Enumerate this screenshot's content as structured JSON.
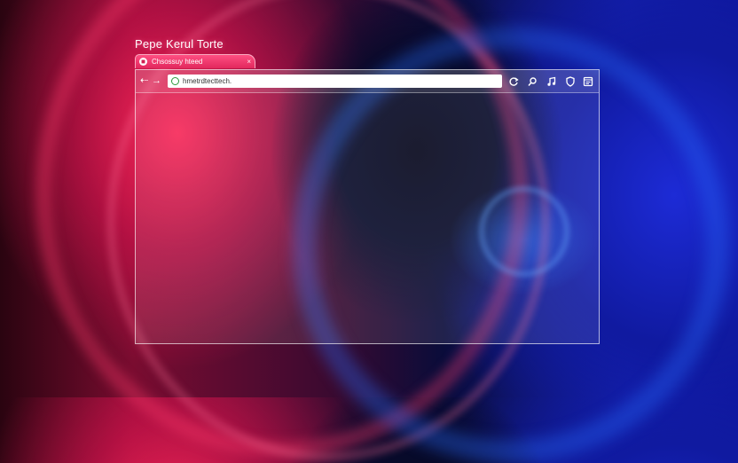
{
  "page": {
    "title": "Pepe Kerul Torte"
  },
  "tab": {
    "label": "Chsossuy hteed",
    "icon": "page-icon",
    "close": "×"
  },
  "toolbar": {
    "back": "⇠",
    "forward": "→",
    "address": "hmetrdtecttech.",
    "address_icon": "secure-icon",
    "tools": [
      "refresh-icon",
      "pin-icon",
      "music-icon",
      "shield-icon",
      "window-icon"
    ]
  },
  "colors": {
    "tab": "#ff4f82",
    "window_border": "#ffffff",
    "address_bg": "#ffffff"
  }
}
